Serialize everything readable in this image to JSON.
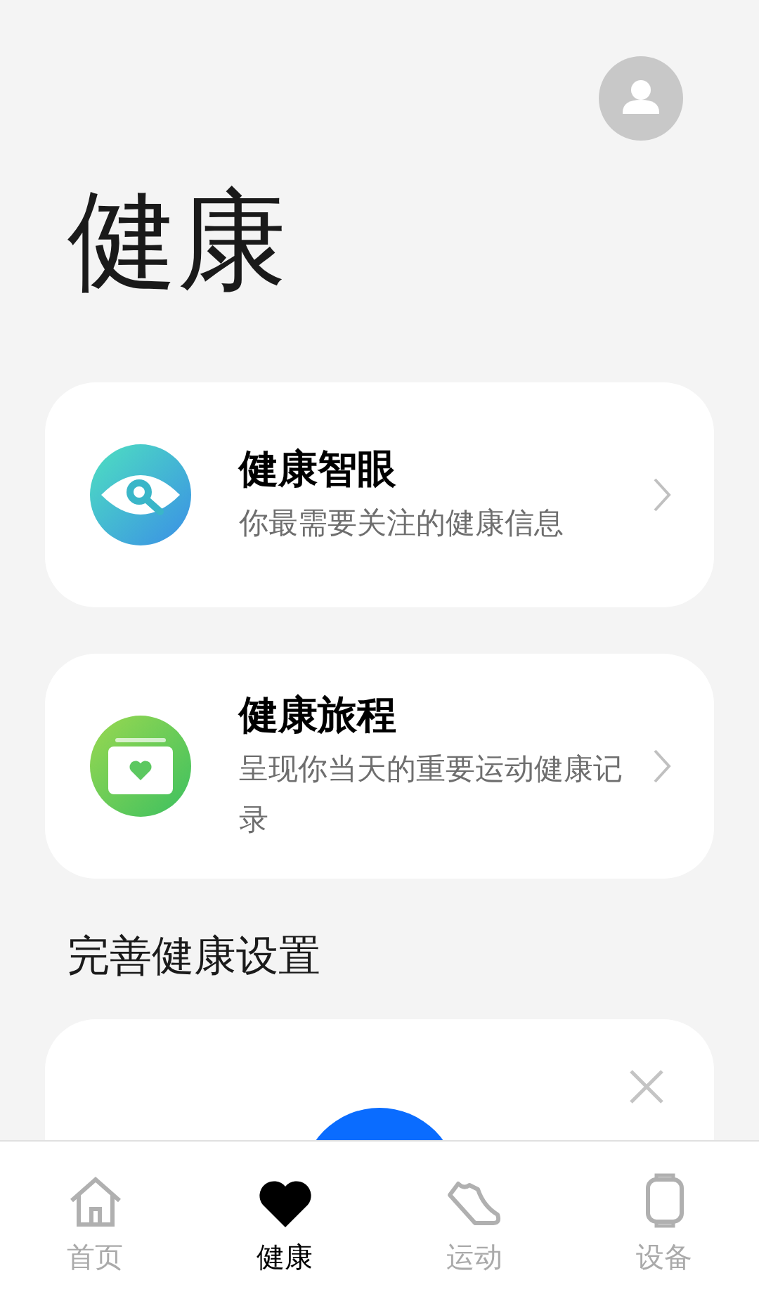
{
  "header": {
    "title": "健康"
  },
  "cards": [
    {
      "kind": "eye",
      "title": "健康智眼",
      "subtitle": "你最需要关注的健康信息"
    },
    {
      "kind": "journey",
      "title": "健康旅程",
      "subtitle": "呈现你当天的重要运动健康记录"
    }
  ],
  "section": {
    "title": "完善健康设置"
  },
  "bottom_nav": [
    {
      "kind": "home",
      "label": "首页",
      "selected": false
    },
    {
      "kind": "heart",
      "label": "健康",
      "selected": true
    },
    {
      "kind": "shoe",
      "label": "运动",
      "selected": false
    },
    {
      "kind": "watch",
      "label": "设备",
      "selected": false
    }
  ]
}
